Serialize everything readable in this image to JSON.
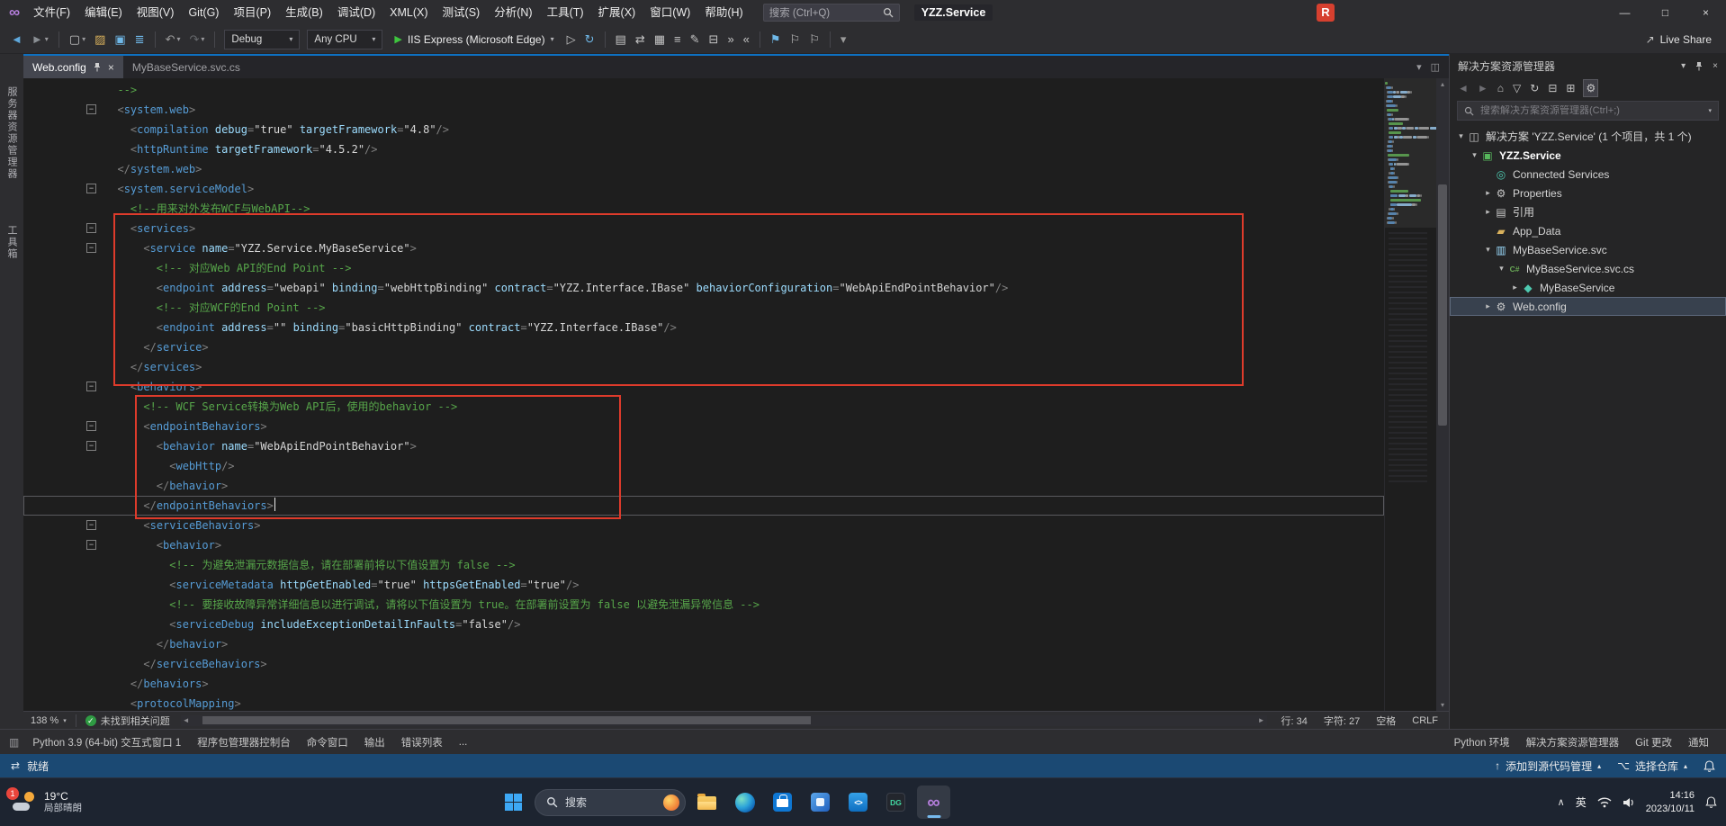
{
  "icons": {
    "minus": "−",
    "chevron_down": "▾",
    "chevron_right": "▸",
    "chevron_up": "▴",
    "close": "×",
    "minimize": "—",
    "maximize": "□",
    "check": "✓",
    "play": "▶",
    "up_arrow": "↑",
    "left_arrow": "◄",
    "right_arrow": "►",
    "window_split": "◫",
    "tasks": "⇄",
    "branch": "⌥",
    "tray_chevron": "∧",
    "logo_infinity": "∞",
    "share": "↗",
    "panel": "▥"
  },
  "titlebar": {
    "menus": [
      "文件(F)",
      "编辑(E)",
      "视图(V)",
      "Git(G)",
      "项目(P)",
      "生成(B)",
      "调试(D)",
      "XML(X)",
      "测试(S)",
      "分析(N)",
      "工具(T)",
      "扩展(X)",
      "窗口(W)",
      "帮助(H)"
    ],
    "search_placeholder": "搜索 (Ctrl+Q)",
    "solution_name": "YZZ.Service",
    "r_icon": "R"
  },
  "toolbar": {
    "debug_config": "Debug",
    "platform": "Any CPU",
    "run_label": "IIS Express (Microsoft Edge)",
    "live_share": "Live Share",
    "items": [
      {
        "t": "icon",
        "name": "navigate-backward-icon",
        "g": "◄",
        "c": "#5FA8DC"
      },
      {
        "t": "icon",
        "name": "navigate-forward-icon",
        "g": "►",
        "c": "#8A8F94",
        "chev": true
      },
      {
        "t": "sep"
      },
      {
        "t": "icon",
        "name": "new-project-icon",
        "g": "▢",
        "c": "#C5C5C5",
        "chev": true
      },
      {
        "t": "icon",
        "name": "open-file-icon",
        "g": "▨",
        "c": "#D9B15C"
      },
      {
        "t": "icon",
        "name": "save-icon",
        "g": "▣",
        "c": "#6FB8E8"
      },
      {
        "t": "icon",
        "name": "save-all-icon",
        "g": "≣",
        "c": "#6FB8E8"
      },
      {
        "t": "sep"
      },
      {
        "t": "icon",
        "name": "undo-icon",
        "g": "↶",
        "c": "#9B9B9B",
        "chev": true
      },
      {
        "t": "icon",
        "name": "redo-icon",
        "g": "↷",
        "c": "#66686C",
        "chev": true
      },
      {
        "t": "sep"
      },
      {
        "t": "combo",
        "name": "solution-configurations-combo",
        "key": "debug_config"
      },
      {
        "t": "combo",
        "name": "solution-platforms-combo",
        "key": "platform"
      },
      {
        "t": "run"
      },
      {
        "t": "icon",
        "name": "start-without-debugging-icon",
        "g": "▷",
        "c": "#C5C5C5"
      },
      {
        "t": "icon",
        "name": "refresh-icon",
        "g": "↻",
        "c": "#6FB8E8"
      },
      {
        "t": "sep"
      },
      {
        "t": "icon",
        "name": "find-icon",
        "g": "▤",
        "c": "#C5C5C5"
      },
      {
        "t": "icon",
        "name": "sync-with-active-document-icon",
        "g": "⇄",
        "c": "#C5C5C5"
      },
      {
        "t": "icon",
        "name": "xml-schema-icon",
        "g": "▦",
        "c": "#C5C5C5"
      },
      {
        "t": "icon",
        "name": "format-document-icon",
        "g": "≡",
        "c": "#C5C5C5"
      },
      {
        "t": "icon",
        "name": "comment-icon",
        "g": "✎",
        "c": "#C5C5C5"
      },
      {
        "t": "icon",
        "name": "uncomment-icon",
        "g": "⊟",
        "c": "#C5C5C5"
      },
      {
        "t": "icon",
        "name": "indent-increase-icon",
        "g": "»",
        "c": "#C5C5C5"
      },
      {
        "t": "icon",
        "name": "indent-decrease-icon",
        "g": "«",
        "c": "#C5C5C5"
      },
      {
        "t": "sep"
      },
      {
        "t": "icon",
        "name": "bookmark-toggle-icon",
        "g": "⚑",
        "c": "#6FB8E8"
      },
      {
        "t": "icon",
        "name": "bookmark-previous-icon",
        "g": "⚐",
        "c": "#C5C5C5"
      },
      {
        "t": "icon",
        "name": "bookmark-next-icon",
        "g": "⚐",
        "c": "#C5C5C5"
      },
      {
        "t": "sep"
      },
      {
        "t": "icon",
        "name": "toolbar-options-icon",
        "g": "▾",
        "c": "#9B9B9B"
      }
    ]
  },
  "editor_tabs": [
    {
      "label": "Web.config",
      "active": true
    },
    {
      "label": "MyBaseService.svc.cs",
      "active": false
    }
  ],
  "left_rail": [
    "服务器资源管理器",
    "工具箱"
  ],
  "editor": {
    "cursor_line": 22,
    "annotation_color": "#DE3B2B",
    "fold_lines": [
      2,
      6,
      8,
      9,
      16,
      18,
      19,
      23,
      24
    ],
    "lines": [
      [
        [
          "c",
          "  -->"
        ]
      ],
      [
        [
          "w",
          "  "
        ],
        [
          "p",
          "<"
        ],
        [
          "t",
          "system.web"
        ],
        [
          "p",
          ">"
        ]
      ],
      [
        [
          "w",
          "    "
        ],
        [
          "p",
          "<"
        ],
        [
          "t",
          "compilation"
        ],
        [
          "w",
          " "
        ],
        [
          "a",
          "debug"
        ],
        [
          "p",
          "="
        ],
        [
          "v",
          "\"true\""
        ],
        [
          "w",
          " "
        ],
        [
          "a",
          "targetFramework"
        ],
        [
          "p",
          "="
        ],
        [
          "v",
          "\"4.8\""
        ],
        [
          "p",
          "/>"
        ]
      ],
      [
        [
          "w",
          "    "
        ],
        [
          "p",
          "<"
        ],
        [
          "t",
          "httpRuntime"
        ],
        [
          "w",
          " "
        ],
        [
          "a",
          "targetFramework"
        ],
        [
          "p",
          "="
        ],
        [
          "v",
          "\"4.5.2\""
        ],
        [
          "p",
          "/>"
        ]
      ],
      [
        [
          "w",
          "  "
        ],
        [
          "p",
          "</"
        ],
        [
          "t",
          "system.web"
        ],
        [
          "p",
          ">"
        ]
      ],
      [
        [
          "w",
          "  "
        ],
        [
          "p",
          "<"
        ],
        [
          "t",
          "system.serviceModel"
        ],
        [
          "p",
          ">"
        ]
      ],
      [
        [
          "w",
          "    "
        ],
        [
          "c",
          "<!--用来对外发布WCF与WebAPI-->"
        ]
      ],
      [
        [
          "w",
          "    "
        ],
        [
          "p",
          "<"
        ],
        [
          "t",
          "services"
        ],
        [
          "p",
          ">"
        ]
      ],
      [
        [
          "w",
          "      "
        ],
        [
          "p",
          "<"
        ],
        [
          "t",
          "service"
        ],
        [
          "w",
          " "
        ],
        [
          "a",
          "name"
        ],
        [
          "p",
          "="
        ],
        [
          "v",
          "\"YZZ.Service.MyBaseService\""
        ],
        [
          "p",
          ">"
        ]
      ],
      [
        [
          "w",
          "        "
        ],
        [
          "c",
          "<!-- 对应Web API的End Point -->"
        ]
      ],
      [
        [
          "w",
          "        "
        ],
        [
          "p",
          "<"
        ],
        [
          "t",
          "endpoint"
        ],
        [
          "w",
          " "
        ],
        [
          "a",
          "address"
        ],
        [
          "p",
          "="
        ],
        [
          "v",
          "\"webapi\""
        ],
        [
          "w",
          " "
        ],
        [
          "a",
          "binding"
        ],
        [
          "p",
          "="
        ],
        [
          "v",
          "\"webHttpBinding\""
        ],
        [
          "w",
          " "
        ],
        [
          "a",
          "contract"
        ],
        [
          "p",
          "="
        ],
        [
          "v",
          "\"YZZ.Interface.IBase\""
        ],
        [
          "w",
          " "
        ],
        [
          "a",
          "behaviorConfiguration"
        ],
        [
          "p",
          "="
        ],
        [
          "v",
          "\"WebApiEndPointBehavior\""
        ],
        [
          "p",
          "/>"
        ]
      ],
      [
        [
          "w",
          "        "
        ],
        [
          "c",
          "<!-- 对应WCF的End Point -->"
        ]
      ],
      [
        [
          "w",
          "        "
        ],
        [
          "p",
          "<"
        ],
        [
          "t",
          "endpoint"
        ],
        [
          "w",
          " "
        ],
        [
          "a",
          "address"
        ],
        [
          "p",
          "="
        ],
        [
          "v",
          "\"\""
        ],
        [
          "w",
          " "
        ],
        [
          "a",
          "binding"
        ],
        [
          "p",
          "="
        ],
        [
          "v",
          "\"basicHttpBinding\""
        ],
        [
          "w",
          " "
        ],
        [
          "a",
          "contract"
        ],
        [
          "p",
          "="
        ],
        [
          "v",
          "\"YZZ.Interface.IBase\""
        ],
        [
          "p",
          "/>"
        ]
      ],
      [
        [
          "w",
          "      "
        ],
        [
          "p",
          "</"
        ],
        [
          "t",
          "service"
        ],
        [
          "p",
          ">"
        ]
      ],
      [
        [
          "w",
          "    "
        ],
        [
          "p",
          "</"
        ],
        [
          "t",
          "services"
        ],
        [
          "p",
          ">"
        ]
      ],
      [
        [
          "w",
          "    "
        ],
        [
          "p",
          "<"
        ],
        [
          "t",
          "behaviors"
        ],
        [
          "p",
          ">"
        ]
      ],
      [
        [
          "w",
          "      "
        ],
        [
          "c",
          "<!-- WCF Service转换为Web API后，使用的behavior -->"
        ]
      ],
      [
        [
          "w",
          "      "
        ],
        [
          "p",
          "<"
        ],
        [
          "t",
          "endpointBehaviors"
        ],
        [
          "p",
          ">"
        ]
      ],
      [
        [
          "w",
          "        "
        ],
        [
          "p",
          "<"
        ],
        [
          "t",
          "behavior"
        ],
        [
          "w",
          " "
        ],
        [
          "a",
          "name"
        ],
        [
          "p",
          "="
        ],
        [
          "v",
          "\"WebApiEndPointBehavior\""
        ],
        [
          "p",
          ">"
        ]
      ],
      [
        [
          "w",
          "          "
        ],
        [
          "p",
          "<"
        ],
        [
          "t",
          "webHttp"
        ],
        [
          "p",
          "/>"
        ]
      ],
      [
        [
          "w",
          "        "
        ],
        [
          "p",
          "</"
        ],
        [
          "t",
          "behavior"
        ],
        [
          "p",
          ">"
        ]
      ],
      [
        [
          "w",
          "      "
        ],
        [
          "p",
          "</"
        ],
        [
          "t",
          "endpointBehaviors"
        ],
        [
          "p",
          ">"
        ]
      ],
      [
        [
          "w",
          "      "
        ],
        [
          "p",
          "<"
        ],
        [
          "t",
          "serviceBehaviors"
        ],
        [
          "p",
          ">"
        ]
      ],
      [
        [
          "w",
          "        "
        ],
        [
          "p",
          "<"
        ],
        [
          "t",
          "behavior"
        ],
        [
          "p",
          ">"
        ]
      ],
      [
        [
          "w",
          "          "
        ],
        [
          "c",
          "<!-- 为避免泄漏元数据信息，请在部署前将以下值设置为 false -->"
        ]
      ],
      [
        [
          "w",
          "          "
        ],
        [
          "p",
          "<"
        ],
        [
          "t",
          "serviceMetadata"
        ],
        [
          "w",
          " "
        ],
        [
          "a",
          "httpGetEnabled"
        ],
        [
          "p",
          "="
        ],
        [
          "v",
          "\"true\""
        ],
        [
          "w",
          " "
        ],
        [
          "a",
          "httpsGetEnabled"
        ],
        [
          "p",
          "="
        ],
        [
          "v",
          "\"true\""
        ],
        [
          "p",
          "/>"
        ]
      ],
      [
        [
          "w",
          "          "
        ],
        [
          "c",
          "<!-- 要接收故障异常详细信息以进行调试，请将以下值设置为 true。在部署前设置为 false 以避免泄漏异常信息 -->"
        ]
      ],
      [
        [
          "w",
          "          "
        ],
        [
          "p",
          "<"
        ],
        [
          "t",
          "serviceDebug"
        ],
        [
          "w",
          " "
        ],
        [
          "a",
          "includeExceptionDetailInFaults"
        ],
        [
          "p",
          "="
        ],
        [
          "v",
          "\"false\""
        ],
        [
          "p",
          "/>"
        ]
      ],
      [
        [
          "w",
          "        "
        ],
        [
          "p",
          "</"
        ],
        [
          "t",
          "behavior"
        ],
        [
          "p",
          ">"
        ]
      ],
      [
        [
          "w",
          "      "
        ],
        [
          "p",
          "</"
        ],
        [
          "t",
          "serviceBehaviors"
        ],
        [
          "p",
          ">"
        ]
      ],
      [
        [
          "w",
          "    "
        ],
        [
          "p",
          "</"
        ],
        [
          "t",
          "behaviors"
        ],
        [
          "p",
          ">"
        ]
      ],
      [
        [
          "w",
          "    "
        ],
        [
          "p",
          "<"
        ],
        [
          "t",
          "protocolMapping"
        ],
        [
          "p",
          ">"
        ]
      ]
    ]
  },
  "editor_status": {
    "zoom": "138 %",
    "problems": "未找到相关问题",
    "line": "行: 34",
    "column": "字符: 27",
    "spaces": "空格",
    "eol": "CRLF"
  },
  "solution_explorer": {
    "title": "解决方案资源管理器",
    "search_placeholder": "搜索解决方案资源管理器(Ctrl+;)",
    "toolbar": [
      {
        "name": "se-back-icon",
        "g": "◄",
        "c": "#6E6E73"
      },
      {
        "name": "se-forward-icon",
        "g": "►",
        "c": "#6E6E73"
      },
      {
        "name": "se-home-icon",
        "g": "⌂",
        "c": "#C5C5C5"
      },
      {
        "name": "se-filter-icon",
        "g": "▽",
        "c": "#C5C5C5"
      },
      {
        "name": "se-refresh-icon",
        "g": "↻",
        "c": "#C5C5C5"
      },
      {
        "name": "se-collapse-all-icon",
        "g": "⊟",
        "c": "#C5C5C5"
      },
      {
        "name": "se-show-all-files-icon",
        "g": "⊞",
        "c": "#C5C5C5"
      },
      {
        "name": "se-switch-views-icon",
        "g": "⚙",
        "c": "#C5C5C5",
        "hl": true
      }
    ],
    "items": [
      {
        "id": "solution",
        "label": "解决方案 'YZZ.Service' (1 个项目，共 1 个)",
        "level": 0,
        "arrow": "expanded",
        "icon": "solution-icon",
        "g": "◫",
        "c": "#C8C8C8"
      },
      {
        "id": "project-yzz-service",
        "label": "YZZ.Service",
        "level": 1,
        "arrow": "expanded",
        "icon": "web-project-icon",
        "g": "▣",
        "c": "#57B85C",
        "bold": true
      },
      {
        "id": "connected-services",
        "label": "Connected Services",
        "level": 2,
        "arrow": "none",
        "icon": "connected-services-icon",
        "g": "◎",
        "c": "#4EC9B0"
      },
      {
        "id": "properties",
        "label": "Properties",
        "level": 2,
        "arrow": "collapsed",
        "icon": "properties-icon",
        "g": "⚙",
        "c": "#C5C5C5"
      },
      {
        "id": "references",
        "label": "引用",
        "level": 2,
        "arrow": "collapsed",
        "icon": "references-icon",
        "g": "▤",
        "c": "#C5C5C5"
      },
      {
        "id": "app-data",
        "label": "App_Data",
        "level": 2,
        "arrow": "none",
        "icon": "folder-icon",
        "g": "▰",
        "c": "#D9B15C"
      },
      {
        "id": "mybaseservice-svc",
        "label": "MyBaseService.svc",
        "level": 2,
        "arrow": "expanded",
        "icon": "svc-file-icon",
        "g": "▥",
        "c": "#9CDCFE"
      },
      {
        "id": "mybaseservice-svc-cs",
        "label": "MyBaseService.svc.cs",
        "level": 3,
        "arrow": "expanded",
        "icon": "csharp-file-icon",
        "g": "C#",
        "c": "#69A856",
        "small": true
      },
      {
        "id": "mybaseservice-class",
        "label": "MyBaseService",
        "level": 4,
        "arrow": "collapsed",
        "icon": "class-icon",
        "g": "◆",
        "c": "#4EC9B0"
      },
      {
        "id": "web-config",
        "label": "Web.config",
        "level": 2,
        "arrow": "collapsed",
        "icon": "config-file-icon",
        "g": "⚙",
        "c": "#C8C8C8",
        "selected": true
      }
    ]
  },
  "bottom_tabs": {
    "left": [
      {
        "id": "python-interactive",
        "label": "Python 3.9 (64-bit) 交互式窗口 1"
      },
      {
        "id": "package-manager-console",
        "label": "程序包管理器控制台"
      },
      {
        "id": "command-window",
        "label": "命令窗口"
      },
      {
        "id": "output",
        "label": "输出"
      },
      {
        "id": "error-list",
        "label": "错误列表"
      },
      {
        "id": "overflow",
        "label": "..."
      }
    ],
    "right": [
      {
        "id": "python-environments",
        "label": "Python 环境"
      },
      {
        "id": "solution-explorer",
        "label": "解决方案资源管理器"
      },
      {
        "id": "git-changes",
        "label": "Git 更改"
      },
      {
        "id": "notifications",
        "label": "通知"
      }
    ]
  },
  "statusbar": {
    "ready": "就绪",
    "add_to_source_control": "添加到源代码管理",
    "select_repo": "选择仓库"
  },
  "taskbar": {
    "search_label": "搜索",
    "weather": {
      "badge": "1",
      "temp": "19°C",
      "desc": "局部晴朗"
    },
    "apps": [
      {
        "type": "folder",
        "name": "file-explorer-icon"
      },
      {
        "type": "edge",
        "name": "edge-icon"
      },
      {
        "type": "store",
        "name": "store-icon"
      },
      {
        "type": "teams",
        "name": "teams-icon"
      },
      {
        "type": "vscode",
        "name": "vscode-icon",
        "label": "<>"
      },
      {
        "type": "dg",
        "name": "datagrip-icon",
        "label": "DG"
      },
      {
        "type": "vs",
        "name": "visual-studio-icon",
        "label": "∞",
        "active": true
      }
    ],
    "tray": {
      "ime": "英",
      "time": "14:16",
      "date": "2023/10/11"
    }
  }
}
